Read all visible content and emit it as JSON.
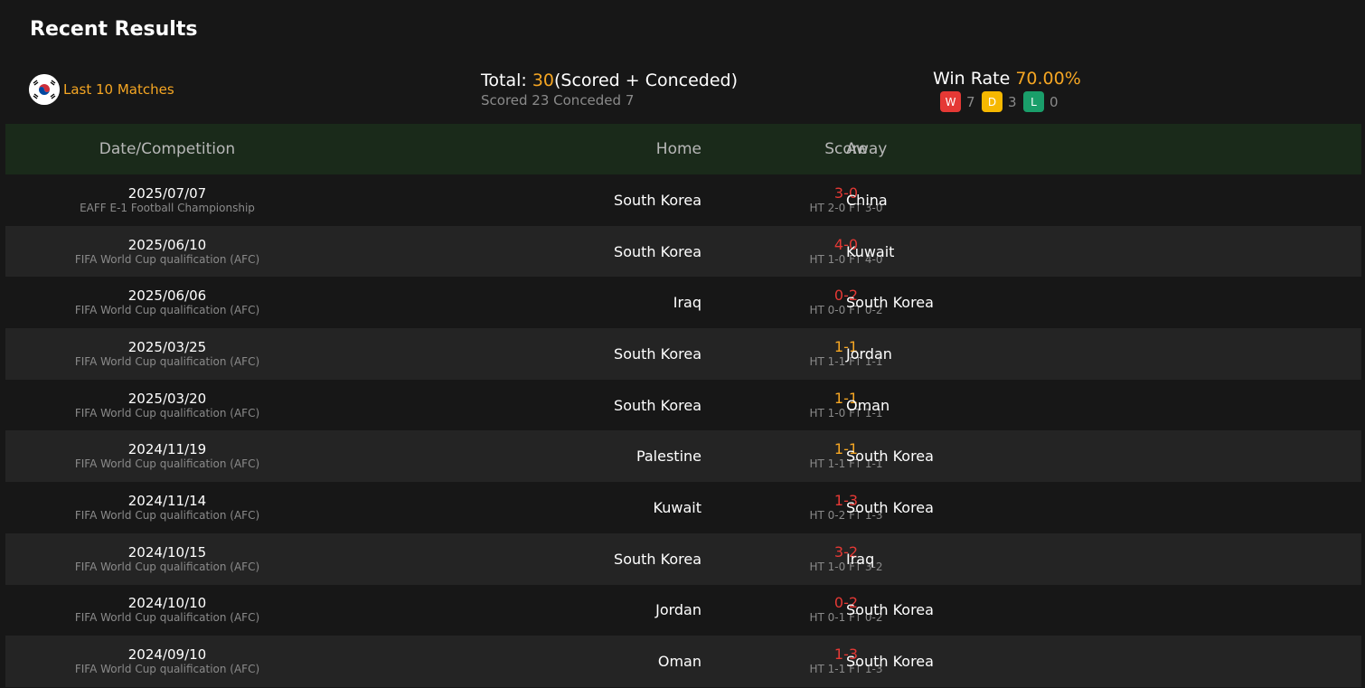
{
  "header": {
    "title": "Recent Results"
  },
  "summary": {
    "team_label": "Last 10 Matches",
    "total_prefix": "Total: ",
    "total_value": "30",
    "total_suffix": "(Scored + Conceded)",
    "scored_conceded": "Scored 23 Conceded 7",
    "winrate_prefix": "Win Rate ",
    "winrate_value": "70.00%",
    "w_label": "W",
    "w_count": "7",
    "d_label": "D",
    "d_count": "3",
    "l_label": "L",
    "l_count": "0"
  },
  "colors": {
    "accent": "#f5a623",
    "win": "#e53935",
    "draw": "#f6b800",
    "loss": "#1a9e6a",
    "header_bg": "#1a2a1a"
  },
  "table": {
    "headers": {
      "date": "Date/Competition",
      "home": "Home",
      "score": "Score",
      "away": "Away"
    },
    "rows": [
      {
        "date": "2025/07/07",
        "comp": "EAFF E-1 Football Championship",
        "home": "South Korea",
        "score": "3-0",
        "result": "win",
        "ht": "HT 2-0 FT 3-0",
        "away": "China"
      },
      {
        "date": "2025/06/10",
        "comp": "FIFA World Cup qualification (AFC)",
        "home": "South Korea",
        "score": "4-0",
        "result": "win",
        "ht": "HT 1-0 FT 4-0",
        "away": "Kuwait"
      },
      {
        "date": "2025/06/06",
        "comp": "FIFA World Cup qualification (AFC)",
        "home": "Iraq",
        "score": "0-2",
        "result": "win",
        "ht": "HT 0-0 FT 0-2",
        "away": "South Korea"
      },
      {
        "date": "2025/03/25",
        "comp": "FIFA World Cup qualification (AFC)",
        "home": "South Korea",
        "score": "1-1",
        "result": "draw",
        "ht": "HT 1-1 FT 1-1",
        "away": "Jordan"
      },
      {
        "date": "2025/03/20",
        "comp": "FIFA World Cup qualification (AFC)",
        "home": "South Korea",
        "score": "1-1",
        "result": "draw",
        "ht": "HT 1-0 FT 1-1",
        "away": "Oman"
      },
      {
        "date": "2024/11/19",
        "comp": "FIFA World Cup qualification (AFC)",
        "home": "Palestine",
        "score": "1-1",
        "result": "draw",
        "ht": "HT 1-1 FT 1-1",
        "away": "South Korea"
      },
      {
        "date": "2024/11/14",
        "comp": "FIFA World Cup qualification (AFC)",
        "home": "Kuwait",
        "score": "1-3",
        "result": "win",
        "ht": "HT 0-2 FT 1-3",
        "away": "South Korea"
      },
      {
        "date": "2024/10/15",
        "comp": "FIFA World Cup qualification (AFC)",
        "home": "South Korea",
        "score": "3-2",
        "result": "win",
        "ht": "HT 1-0 FT 3-2",
        "away": "Iraq"
      },
      {
        "date": "2024/10/10",
        "comp": "FIFA World Cup qualification (AFC)",
        "home": "Jordan",
        "score": "0-2",
        "result": "win",
        "ht": "HT 0-1 FT 0-2",
        "away": "South Korea"
      },
      {
        "date": "2024/09/10",
        "comp": "FIFA World Cup qualification (AFC)",
        "home": "Oman",
        "score": "1-3",
        "result": "win",
        "ht": "HT 1-1 FT 1-3",
        "away": "South Korea"
      }
    ]
  }
}
